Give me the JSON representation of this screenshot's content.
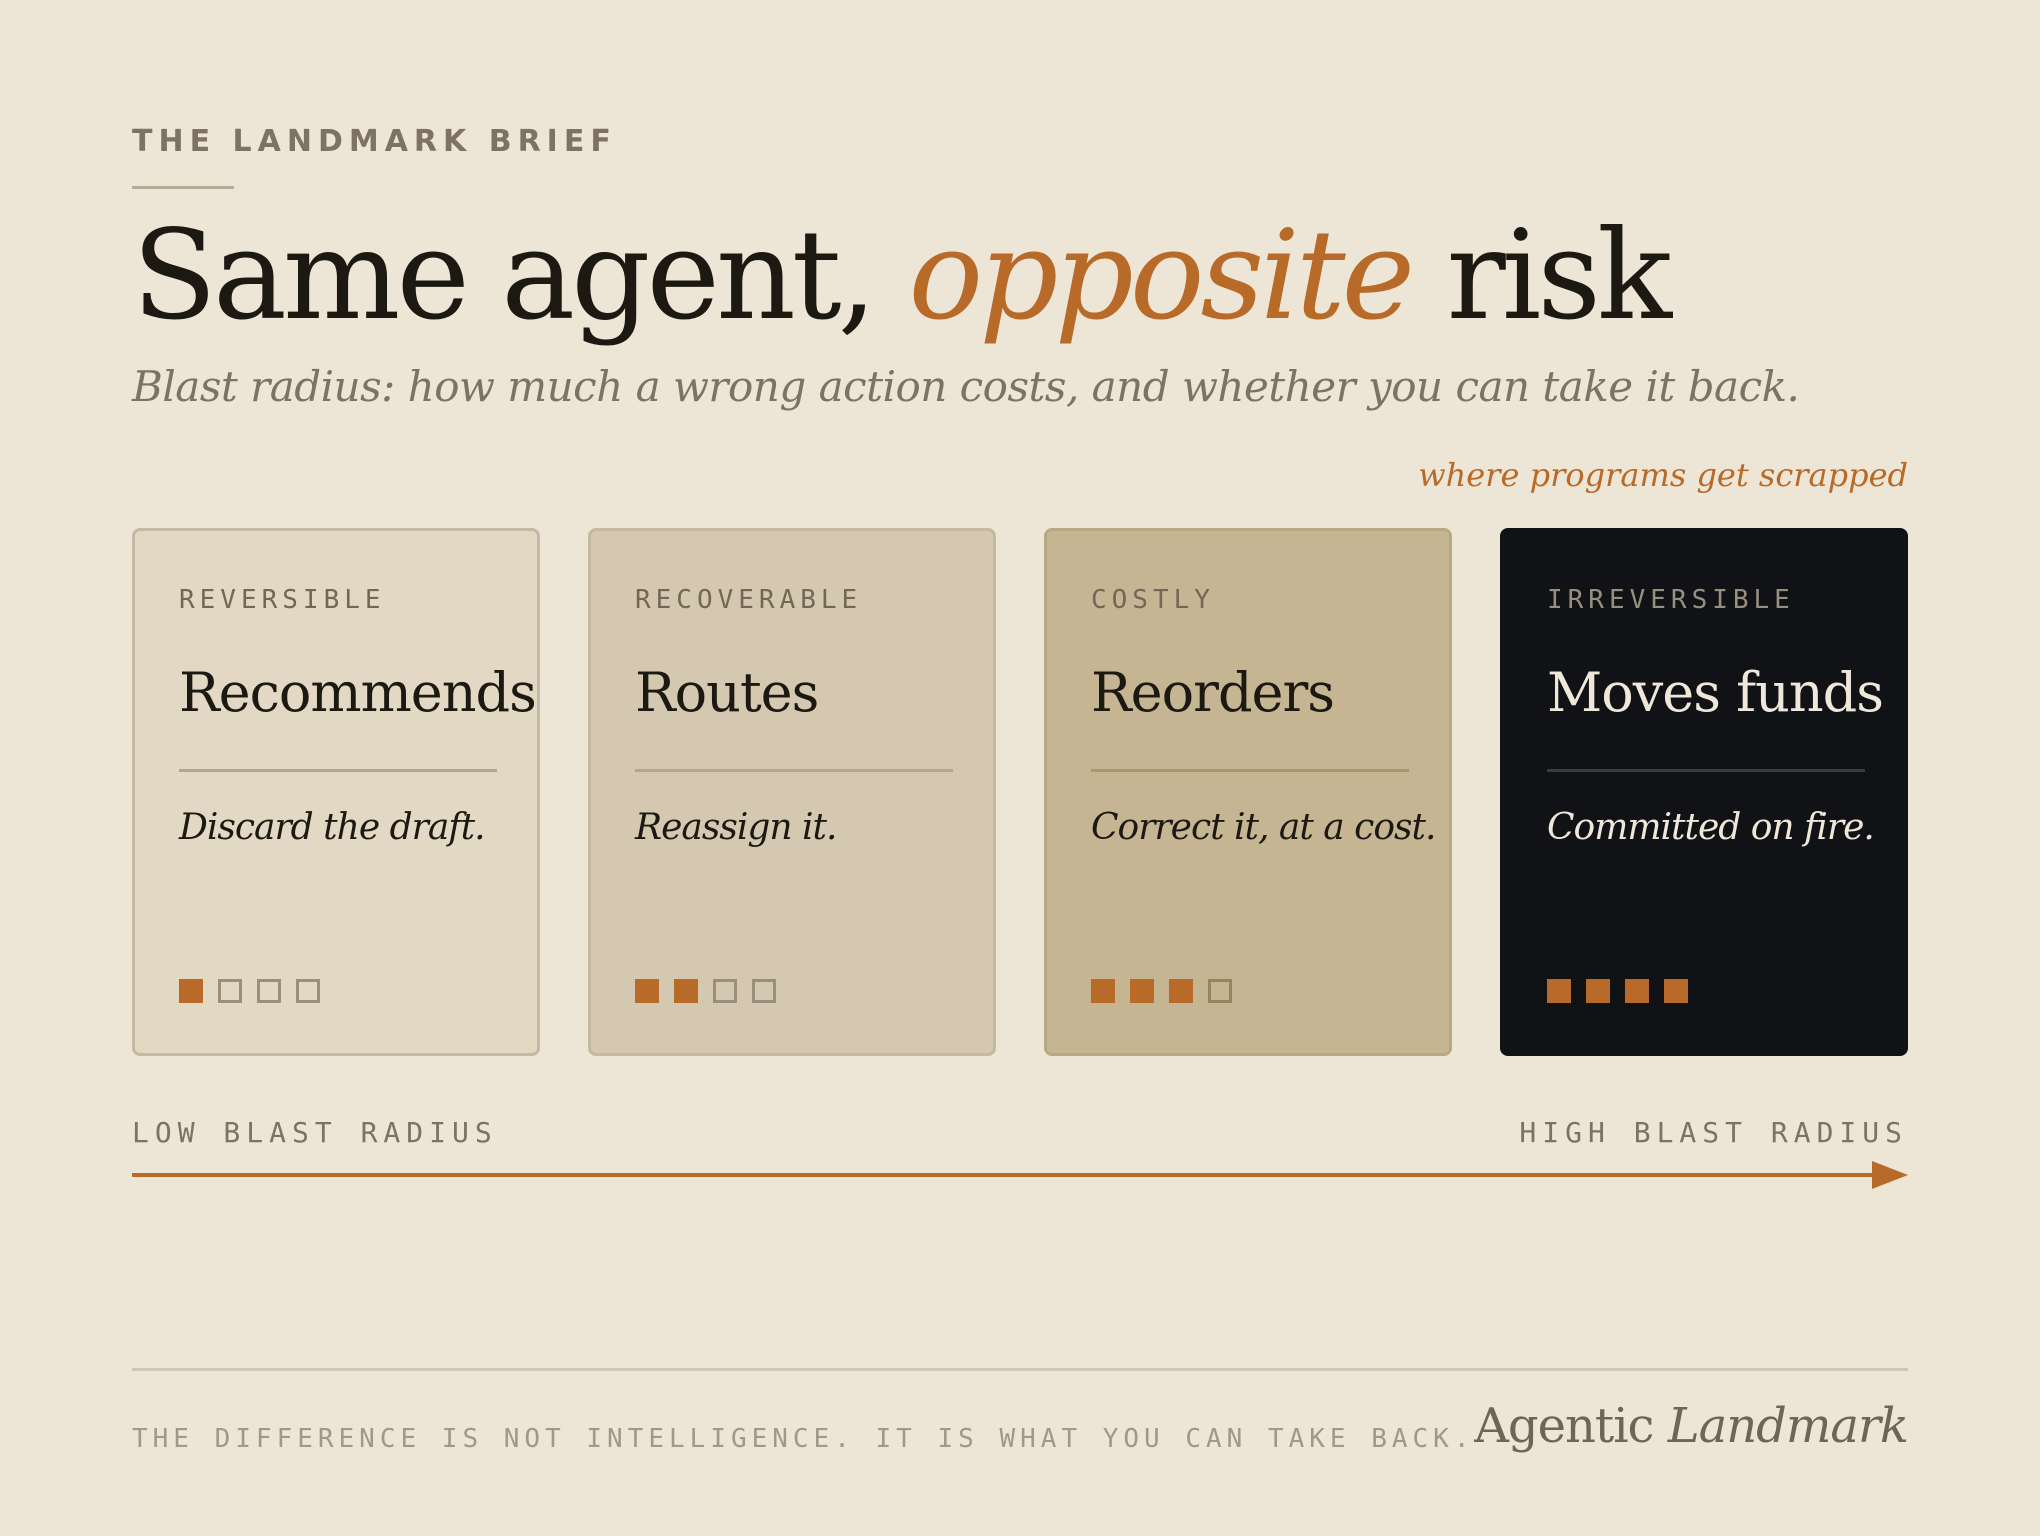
{
  "header": {
    "kicker": "THE LANDMARK BRIEF",
    "headline_before": "Same agent, ",
    "headline_accent": "opposite",
    "headline_after": " risk",
    "subtitle": "Blast radius: how much a wrong action costs, and whether you can take it back."
  },
  "annotation": "where programs get scrapped",
  "cards": [
    {
      "tier": "REVERSIBLE",
      "action": "Recommends",
      "remedy": "Discard the draft.",
      "level": 1,
      "max_level": 4
    },
    {
      "tier": "RECOVERABLE",
      "action": "Routes",
      "remedy": "Reassign it.",
      "level": 2,
      "max_level": 4
    },
    {
      "tier": "COSTLY",
      "action": "Reorders",
      "remedy": "Correct it, at a cost.",
      "level": 3,
      "max_level": 4
    },
    {
      "tier": "IRREVERSIBLE",
      "action": "Moves funds",
      "remedy": "Committed on fire.",
      "level": 4,
      "max_level": 4
    }
  ],
  "axis": {
    "low_label": "LOW BLAST RADIUS",
    "high_label": "HIGH BLAST RADIUS"
  },
  "footer": {
    "tagline": "THE DIFFERENCE IS NOT INTELLIGENCE. IT IS WHAT YOU CAN TAKE BACK.",
    "brand_regular": "Agentic ",
    "brand_italic": "Landmark"
  },
  "colors": {
    "background": "#ede5d6",
    "accent": "#b86a28",
    "ink": "#1c1812",
    "card_reversible": "#e2d8c4",
    "card_recoverable": "#d5c8b0",
    "card_costly": "#c5b592",
    "card_irreversible": "#111215"
  },
  "icons": {
    "meter": "square-pip-icon",
    "axis": "arrow-right-icon"
  }
}
